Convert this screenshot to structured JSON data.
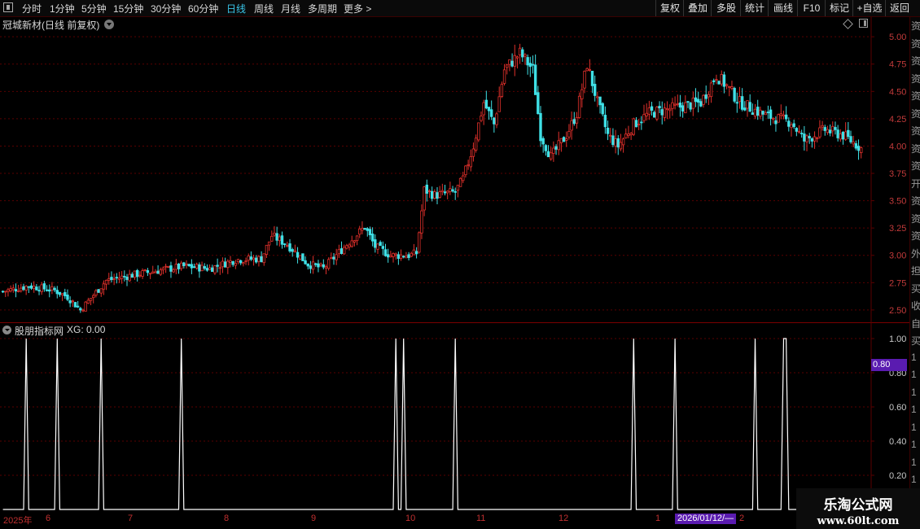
{
  "toolbar": {
    "periods": [
      "分时",
      "1分钟",
      "5分钟",
      "15分钟",
      "30分钟",
      "60分钟",
      "日线",
      "周线",
      "月线",
      "多周期",
      "更多 >"
    ],
    "active_period": "日线",
    "tools": [
      "复权",
      "叠加",
      "多股",
      "统计",
      "画线",
      "F10",
      "标记",
      "+自选",
      "返回"
    ]
  },
  "stock": {
    "title": "冠城新材(日线 前复权)"
  },
  "indicator": {
    "name": "股朋指标网",
    "xg_text": "XG: 0.00",
    "cursor_value": "0.80"
  },
  "dates": {
    "year_label": "2025年",
    "months": [
      "6",
      "7",
      "8",
      "9",
      "10",
      "11",
      "12",
      "1",
      "2"
    ],
    "cursor_date": "2026/01/12/—"
  },
  "watermark": {
    "title": "乐淘公式网",
    "url": "www.60lt.com"
  },
  "right_strip_chars": [
    "资",
    "资",
    "资",
    "资",
    "资",
    "资",
    "资",
    "资",
    "资",
    "开",
    "资",
    "资",
    "资",
    "外",
    "担",
    "买",
    "收",
    "自",
    "买",
    "1",
    "1",
    "1",
    "1",
    "1",
    "1",
    "1",
    "1",
    "1"
  ],
  "colors": {
    "up": "#e0302b",
    "down": "#3fe0e6",
    "grid": "#5a0000",
    "axis_text": "#c23a3a",
    "indicator_line": "#ffffff",
    "active_period": "#39c5e8"
  },
  "chart_data": {
    "type": "candlestick",
    "main": {
      "y_ticks": [
        2.5,
        2.75,
        3.0,
        3.25,
        3.5,
        3.75,
        4.0,
        4.25,
        4.5,
        4.75,
        5.0
      ],
      "ylim": [
        2.38,
        5.18
      ],
      "anchors": [
        [
          0,
          2.67
        ],
        [
          10,
          2.72
        ],
        [
          20,
          2.68
        ],
        [
          25,
          2.62
        ],
        [
          30,
          2.5
        ],
        [
          40,
          2.77
        ],
        [
          50,
          2.82
        ],
        [
          60,
          2.86
        ],
        [
          70,
          2.9
        ],
        [
          80,
          2.88
        ],
        [
          90,
          2.96
        ],
        [
          100,
          2.97
        ],
        [
          104,
          3.18
        ],
        [
          110,
          3.1
        ],
        [
          118,
          2.92
        ],
        [
          124,
          2.88
        ],
        [
          133,
          3.1
        ],
        [
          140,
          3.26
        ],
        [
          144,
          3.08
        ],
        [
          150,
          3.0
        ],
        [
          157,
          3.0
        ],
        [
          160,
          3.02
        ],
        [
          163,
          3.6
        ],
        [
          167,
          3.55
        ],
        [
          175,
          3.58
        ],
        [
          178,
          3.7
        ],
        [
          182,
          4.0
        ],
        [
          186,
          4.4
        ],
        [
          190,
          4.2
        ],
        [
          194,
          4.7
        ],
        [
          200,
          4.85
        ],
        [
          205,
          4.7
        ],
        [
          208,
          4.1
        ],
        [
          212,
          3.9
        ],
        [
          218,
          4.1
        ],
        [
          222,
          4.3
        ],
        [
          226,
          4.75
        ],
        [
          230,
          4.4
        ],
        [
          234,
          4.1
        ],
        [
          238,
          4.0
        ],
        [
          244,
          4.2
        ],
        [
          250,
          4.3
        ],
        [
          260,
          4.35
        ],
        [
          270,
          4.4
        ],
        [
          276,
          4.65
        ],
        [
          280,
          4.55
        ],
        [
          285,
          4.4
        ],
        [
          295,
          4.28
        ],
        [
          305,
          4.22
        ],
        [
          310,
          4.05
        ],
        [
          318,
          4.15
        ],
        [
          325,
          4.1
        ],
        [
          328,
          4.05
        ],
        [
          332,
          3.98
        ]
      ]
    },
    "indicator": {
      "y_ticks": [
        0.2,
        0.4,
        0.6,
        0.8,
        1.0
      ],
      "ylim": [
        0,
        1.0
      ],
      "signal_bars": [
        9,
        21,
        38,
        69,
        152,
        155,
        175,
        244,
        260,
        291,
        302,
        303
      ]
    }
  }
}
